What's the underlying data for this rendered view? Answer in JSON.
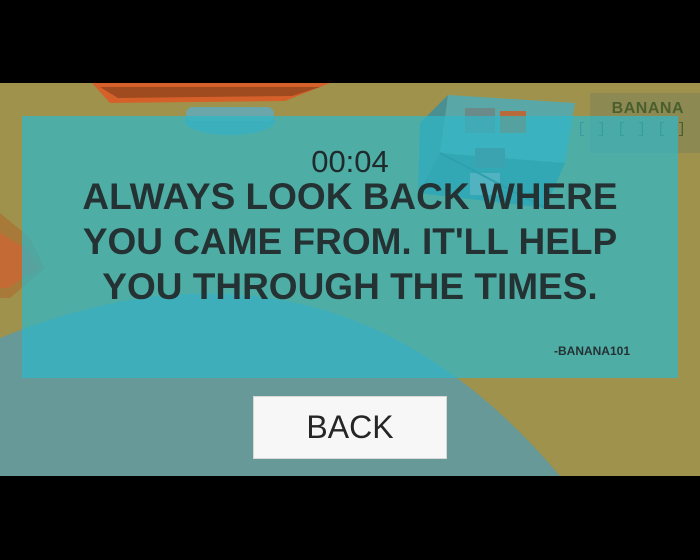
{
  "hud": {
    "collectible_word": "BANANA",
    "letter_slots": "[ ] [ ] [ ]"
  },
  "overlay": {
    "timer": "00:04",
    "quote_lines": [
      "ALWAYS LOOK BACK WHERE",
      "YOU CAME FROM. IT'LL HELP",
      "YOU THROUGH THE TIMES."
    ],
    "author": "-BANANA101"
  },
  "back_button": {
    "label": "BACK"
  },
  "colors": {
    "panel_cyan": "#2fb7c8",
    "ground_olive": "#9e924c",
    "track_orange": "#d5602a",
    "letterbox": "#000000"
  }
}
